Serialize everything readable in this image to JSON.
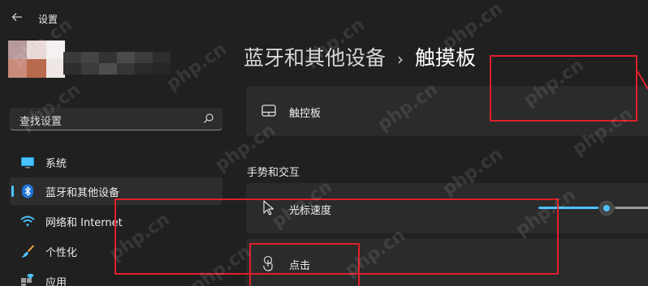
{
  "window": {
    "title": "设置"
  },
  "search": {
    "placeholder": "查找设置"
  },
  "sidebar": {
    "items": [
      {
        "label": "系统",
        "icon": "monitor-icon",
        "active": false
      },
      {
        "label": "蓝牙和其他设备",
        "icon": "bluetooth-icon",
        "active": true
      },
      {
        "label": "网络和 Internet",
        "icon": "wifi-icon",
        "active": false
      },
      {
        "label": "个性化",
        "icon": "brush-icon",
        "active": false
      },
      {
        "label": "应用",
        "icon": "apps-icon",
        "active": false
      }
    ]
  },
  "breadcrumb": {
    "parent": "蓝牙和其他设备",
    "separator": "›",
    "current": "触摸板"
  },
  "main": {
    "touchpad_card": {
      "label": "触控板",
      "icon": "touchpad-icon"
    },
    "section_title": "手势和交互",
    "cursor_speed": {
      "label": "光标速度",
      "icon": "cursor-icon",
      "value_fraction": 0.6
    },
    "tap_card": {
      "label": "点击",
      "icon": "tap-icon"
    }
  },
  "watermark": "php.cn",
  "colors": {
    "background": "#202020",
    "card": "#2b2b2b",
    "accent": "#4cc2ff",
    "annotation": "#e0202a"
  }
}
